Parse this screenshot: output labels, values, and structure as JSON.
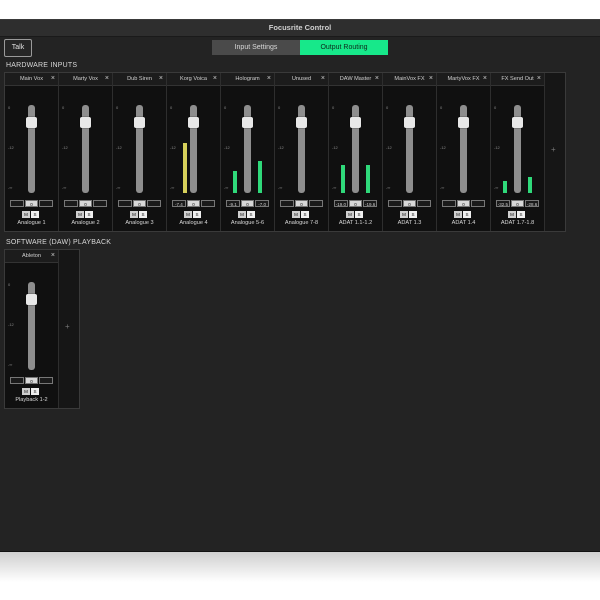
{
  "window": {
    "title": "Focusrite Control"
  },
  "toolbar": {
    "talk_label": "Talk",
    "tabs": [
      {
        "label": "Input Settings",
        "active": false
      },
      {
        "label": "Output Routing",
        "active": true
      }
    ]
  },
  "colors": {
    "accent": "#17e88a",
    "background": "#232323",
    "meter_green": "#2fd97a",
    "meter_yellow": "#d6d05a"
  },
  "hardware": {
    "section_label": "HARDWARE INPUTS",
    "scale_labels": [
      "0",
      "-12",
      "-∞"
    ],
    "strips": [
      {
        "name": "Main Vox",
        "footer": "Analogue 1",
        "values": [
          "",
          "0",
          ""
        ]
      },
      {
        "name": "Marty Vox",
        "footer": "Analogue 2",
        "values": [
          "",
          "0",
          ""
        ]
      },
      {
        "name": "Dub Siren",
        "footer": "Analogue 3",
        "values": [
          "",
          "0",
          ""
        ]
      },
      {
        "name": "Korg Voica",
        "footer": "Analogue 4",
        "values": [
          "-7.4",
          "0",
          ""
        ]
      },
      {
        "name": "Hologram",
        "footer": "Analogue 5-6",
        "values": [
          "-9.1",
          "0",
          "-7.0"
        ]
      },
      {
        "name": "Unused",
        "footer": "Analogue 7-8",
        "values": [
          "",
          "0",
          ""
        ]
      },
      {
        "name": "DAW Master",
        "footer": "ADAT 1.1-1.2",
        "values": [
          "-19.0",
          "0",
          "-19.6"
        ]
      },
      {
        "name": "MainVox FX",
        "footer": "ADAT 1.3",
        "values": [
          "",
          "0",
          ""
        ]
      },
      {
        "name": "MartyVox FX",
        "footer": "ADAT 1.4",
        "values": [
          "",
          "0",
          ""
        ]
      },
      {
        "name": "FX Send Out",
        "footer": "ADAT 1.7-1.8",
        "values": [
          "-32.5",
          "0",
          "-28.6"
        ]
      }
    ],
    "mute_label": "M",
    "solo_label": "S",
    "add_label": "+"
  },
  "software": {
    "section_label": "SOFTWARE (DAW) PLAYBACK",
    "strips": [
      {
        "name": "Ableton",
        "footer": "Playback 1-2",
        "values": [
          "",
          "0",
          ""
        ]
      }
    ],
    "add_label": "+"
  }
}
